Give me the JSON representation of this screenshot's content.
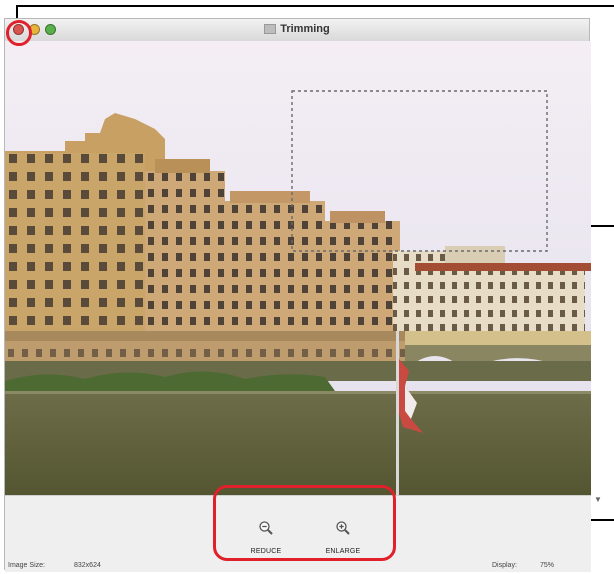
{
  "window": {
    "title": "Trimming",
    "traffic_lights": {
      "close": "close-button",
      "minimize": "minimize-button",
      "zoom": "zoom-button"
    }
  },
  "toolbar": {
    "reduce_label": "REDUCE",
    "enlarge_label": "ENLARGE",
    "reduce_icon": "zoom-out-icon",
    "enlarge_icon": "zoom-in-icon"
  },
  "status": {
    "image_size_label": "Image Size:",
    "image_size_value": "832x624",
    "display_label": "Display:",
    "display_value": "75%"
  },
  "colors": {
    "callout": "#e0202a",
    "sky": "#e6e2ef",
    "river": "#6b6a3a"
  }
}
